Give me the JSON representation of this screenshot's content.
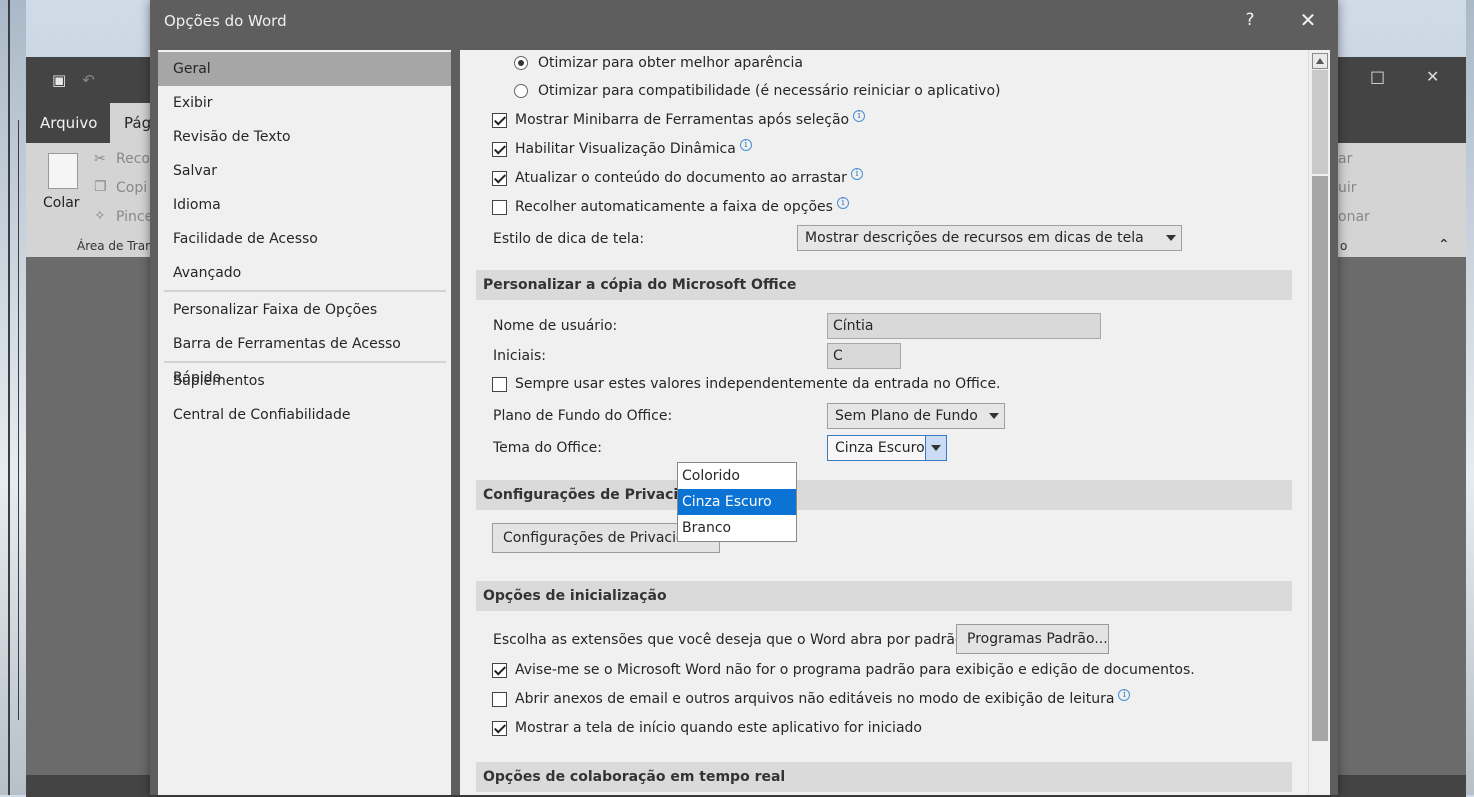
{
  "word_window": {
    "tab_file": "Arquivo",
    "tab_page": "Pági",
    "ribbon": {
      "paste": "Colar",
      "cut": "Reco",
      "copy": "Copi",
      "brush": "Pince",
      "group_clipboard": "Área de Trar",
      "right_1": "ar",
      "right_2": "uir",
      "right_3": "onar",
      "right_group": "o"
    }
  },
  "dialog": {
    "title": "Opções do Word",
    "help": "?",
    "close": "✕"
  },
  "nav": {
    "items": [
      "Geral",
      "Exibir",
      "Revisão de Texto",
      "Salvar",
      "Idioma",
      "Facilidade de Acesso",
      "Avançado",
      "Personalizar Faixa de Opções",
      "Barra de Ferramentas de Acesso Rápido",
      "Suplementos",
      "Central de Confiabilidade"
    ],
    "selected": "Geral"
  },
  "content": {
    "radio_appearance": "Otimizar para obter melhor aparência",
    "radio_compat": "Otimizar para compatibilidade (é necessário reiniciar o aplicativo)",
    "cb_minibar": "Mostrar Minibarra de Ferramentas após seleção",
    "cb_preview": "Habilitar Visualização Dinâmica",
    "cb_update": "Atualizar o conteúdo do documento ao arrastar",
    "cb_collapse": "Recolher automaticamente a faixa de opções",
    "tooltip_label": "Estilo de dica de tela:",
    "tooltip_value": "Mostrar descrições de recursos em dicas de tela",
    "section_personalize": "Personalizar a cópia do Microsoft Office",
    "username_label": "Nome de usuário:",
    "username_value": "Cíntia",
    "initials_label": "Iniciais:",
    "initials_value": "C",
    "cb_always": "Sempre usar estes valores independentemente da entrada no Office.",
    "background_label": "Plano de Fundo do Office:",
    "background_value": "Sem Plano de Fundo",
    "theme_label": "Tema do Office:",
    "theme_value": "Cinza Escuro",
    "theme_options": [
      "Colorido",
      "Cinza Escuro",
      "Branco"
    ],
    "section_privacy": "Configurações de Privacidade",
    "privacy_button": "Configurações de Privacidade...",
    "section_startup": "Opções de inicialização",
    "extensions_label": "Escolha as extensões que você deseja que o Word abra por padrão:",
    "default_programs_button": "Programas Padrão...",
    "cb_notify": "Avise-me se o Microsoft Word não for o programa padrão para exibição e edição de documentos.",
    "cb_attachments": "Abrir anexos de email e outros arquivos não editáveis no modo de exibição de leitura",
    "cb_startscreen": "Mostrar a tela de início quando este aplicativo for iniciado",
    "section_collab": "Opções de colaboração em tempo real"
  },
  "colors": {
    "dialog_frame": "#5e5e5e",
    "panel": "#f0f0f0",
    "selected_nav": "#a6a6a6",
    "section_header": "#dadada",
    "dropdown_highlight": "#0b73d3"
  }
}
